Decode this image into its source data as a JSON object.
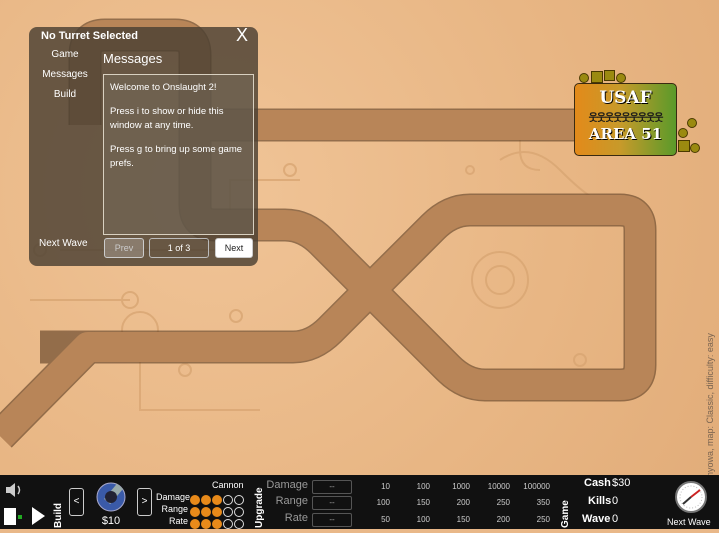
{
  "panel": {
    "title": "No Turret Selected",
    "close_label": "X",
    "nav": [
      "Game",
      "Messages",
      "Build"
    ],
    "next_wave_label": "Next Wave",
    "messages_title": "Messages",
    "messages": [
      "Welcome to Onslaught 2!",
      "Press i to show or hide this window at any time.",
      "Press g to bring up some game prefs."
    ],
    "prev_label": "Prev",
    "page_indicator": "1 of 3",
    "next_label": "Next"
  },
  "base": {
    "line1": "USAF",
    "people": "웃웃웃웃웃웃웃웃웃",
    "line2": "AREA 51"
  },
  "side_text": "2235-nyowa, map: Classic, difficulty: easy",
  "toolbar": {
    "build_label": "Build",
    "prev_turret": "<",
    "next_turret": ">",
    "turret_price": "$10",
    "turret_name": "Cannon",
    "stat_labels": [
      "Damage",
      "Range",
      "Rate"
    ],
    "stat_levels": [
      3,
      3,
      3
    ],
    "upgrade_label": "Upgrade",
    "upgrade_stats": [
      "Damage",
      "Range",
      "Rate"
    ],
    "upgrade_value": "--",
    "upgrade_tables": [
      [
        "10",
        "100",
        "1000",
        "10000",
        "100000"
      ],
      [
        "100",
        "150",
        "200",
        "250",
        "350"
      ],
      [
        "50",
        "100",
        "150",
        "200",
        "250"
      ]
    ],
    "game_label": "Game",
    "cash_label": "Cash",
    "cash_value": "$30",
    "kills_label": "Kills",
    "kills_value": "0",
    "wave_label": "Wave",
    "wave_value": "0",
    "next_wave_label": "Next Wave"
  },
  "colors": {
    "path": "#b88558",
    "panel": "#4a4032",
    "accent": "#e88a1a"
  }
}
